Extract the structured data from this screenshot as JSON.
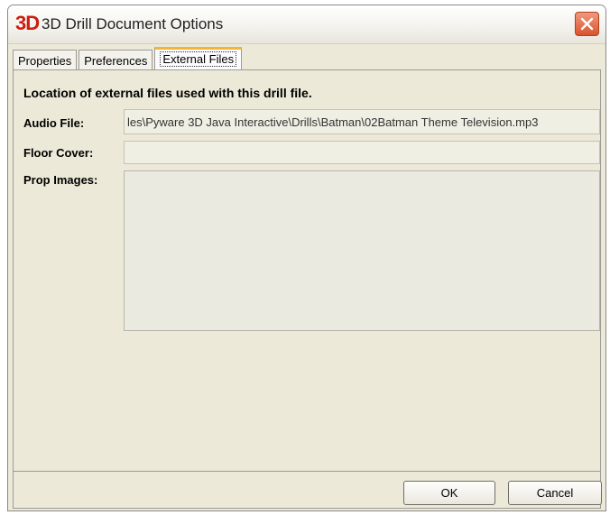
{
  "window": {
    "title": "3D Drill Document Options",
    "logo_text": "3D",
    "close_icon": "close-icon"
  },
  "tabs": [
    {
      "label": "Properties",
      "active": false
    },
    {
      "label": "Preferences",
      "active": false
    },
    {
      "label": "External Files",
      "active": true
    }
  ],
  "panel": {
    "heading": "Location of external files used with this drill file.",
    "audio_file": {
      "label": "Audio File:",
      "value": "les\\Pyware 3D Java Interactive\\Drills\\Batman\\02Batman Theme Television.mp3"
    },
    "floor_cover": {
      "label": "Floor Cover:",
      "value": ""
    },
    "prop_images": {
      "label": "Prop Images:",
      "items": []
    }
  },
  "footer": {
    "ok_label": "OK",
    "cancel_label": "Cancel"
  },
  "colors": {
    "window_bg": "#ece9d8",
    "logo": "#cc1d10",
    "close_button": "#d9542f",
    "active_tab_accent": "#f0b63a"
  }
}
